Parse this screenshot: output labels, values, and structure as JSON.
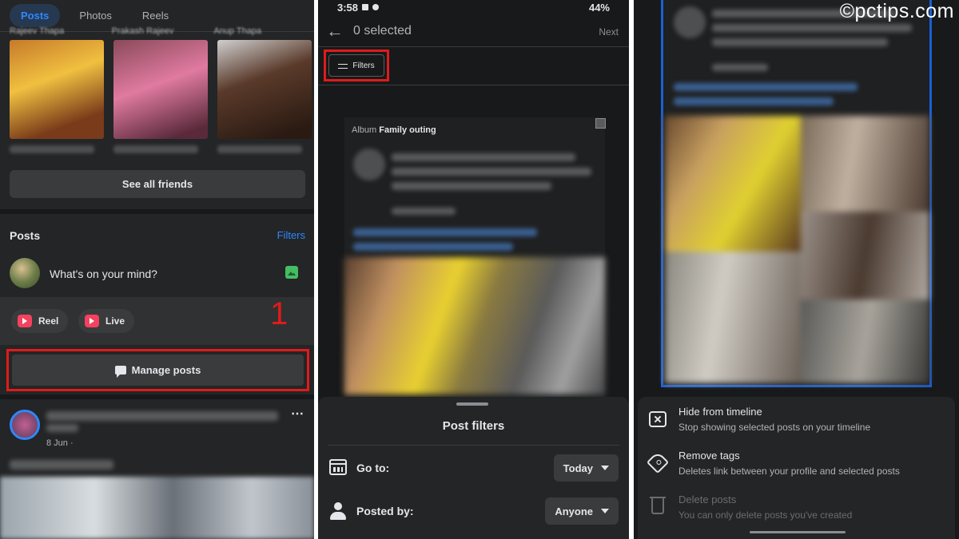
{
  "panel1": {
    "tabs": [
      "Posts",
      "Photos",
      "Reels"
    ],
    "friend_names": [
      "Rajeev Thapa",
      "Prakash Rajeev",
      "Anup Thapa"
    ],
    "see_all_label": "See all friends",
    "posts_heading": "Posts",
    "filters_label": "Filters",
    "composer_placeholder": "What's on your mind?",
    "reel_label": "Reel",
    "live_label": "Live",
    "step_number": "1",
    "manage_posts_label": "Manage posts",
    "post_date": "8 Jun ·",
    "more_icon": "⋯"
  },
  "panel2": {
    "status_time": "3:58",
    "status_right": "44%",
    "back_icon": "←",
    "selected_title": "0 selected",
    "next_label": "Next",
    "filters_label": "Filters",
    "album_prefix": "Album",
    "album_name": "Family outing",
    "sheet_title": "Post filters",
    "goto_label": "Go to:",
    "goto_value": "Today",
    "posted_by_label": "Posted by:",
    "posted_by_value": "Anyone"
  },
  "panel3": {
    "watermark": "©pctips.com",
    "actions": [
      {
        "title": "Hide from timeline",
        "subtitle": "Stop showing selected posts on your timeline",
        "icon": "hide-icon",
        "enabled": true
      },
      {
        "title": "Remove tags",
        "subtitle": "Deletes link between your profile and selected posts",
        "icon": "tag-icon",
        "enabled": true
      },
      {
        "title": "Delete posts",
        "subtitle": "You can only delete posts you've created",
        "icon": "trash-icon",
        "enabled": false
      }
    ]
  },
  "colors": {
    "background_dark": "#18191a",
    "surface": "#242526",
    "accent_blue": "#2d88ff",
    "highlight_red": "#e01b1b"
  }
}
